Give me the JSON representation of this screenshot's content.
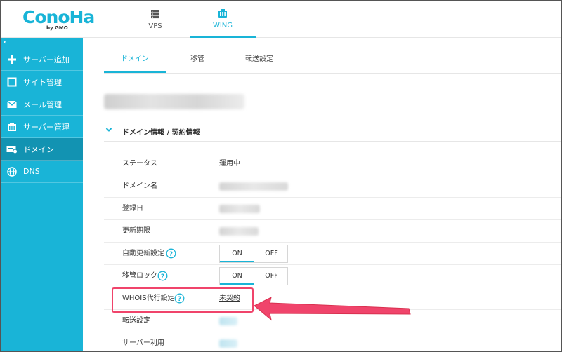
{
  "header": {
    "logo": "ConoHa",
    "logo_sub": "by GMO",
    "tabs": [
      {
        "label": "VPS",
        "icon": "server-icon"
      },
      {
        "label": "WING",
        "icon": "wing-icon",
        "active": true
      }
    ]
  },
  "sidebar": {
    "collapse": "‹",
    "items": [
      {
        "label": "サーバー追加",
        "icon": "plus-icon"
      },
      {
        "label": "サイト管理",
        "icon": "window-icon"
      },
      {
        "label": "メール管理",
        "icon": "mail-icon"
      },
      {
        "label": "サーバー管理",
        "icon": "server-manage-icon"
      },
      {
        "label": "ドメイン",
        "icon": "domain-icon",
        "active": true
      },
      {
        "label": "DNS",
        "icon": "globe-icon"
      }
    ]
  },
  "main": {
    "subtabs": [
      {
        "label": "ドメイン",
        "active": true
      },
      {
        "label": "移管"
      },
      {
        "label": "転送設定"
      }
    ],
    "section_title": "ドメイン情報 / 契約情報",
    "rows": [
      {
        "key": "ステータス",
        "value": "運用中"
      },
      {
        "key": "ドメイン名"
      },
      {
        "key": "登録日"
      },
      {
        "key": "更新期限"
      },
      {
        "key": "自動更新設定",
        "on": "ON",
        "off": "OFF"
      },
      {
        "key": "移管ロック",
        "on": "ON",
        "off": "OFF"
      },
      {
        "key": "WHOIS代行設定",
        "link": "未契約"
      },
      {
        "key": "転送設定"
      },
      {
        "key": "サーバー利用"
      }
    ]
  },
  "colors": {
    "accent": "#19b4d7",
    "sidebar_active": "#1293b2",
    "highlight": "#f0446b"
  }
}
